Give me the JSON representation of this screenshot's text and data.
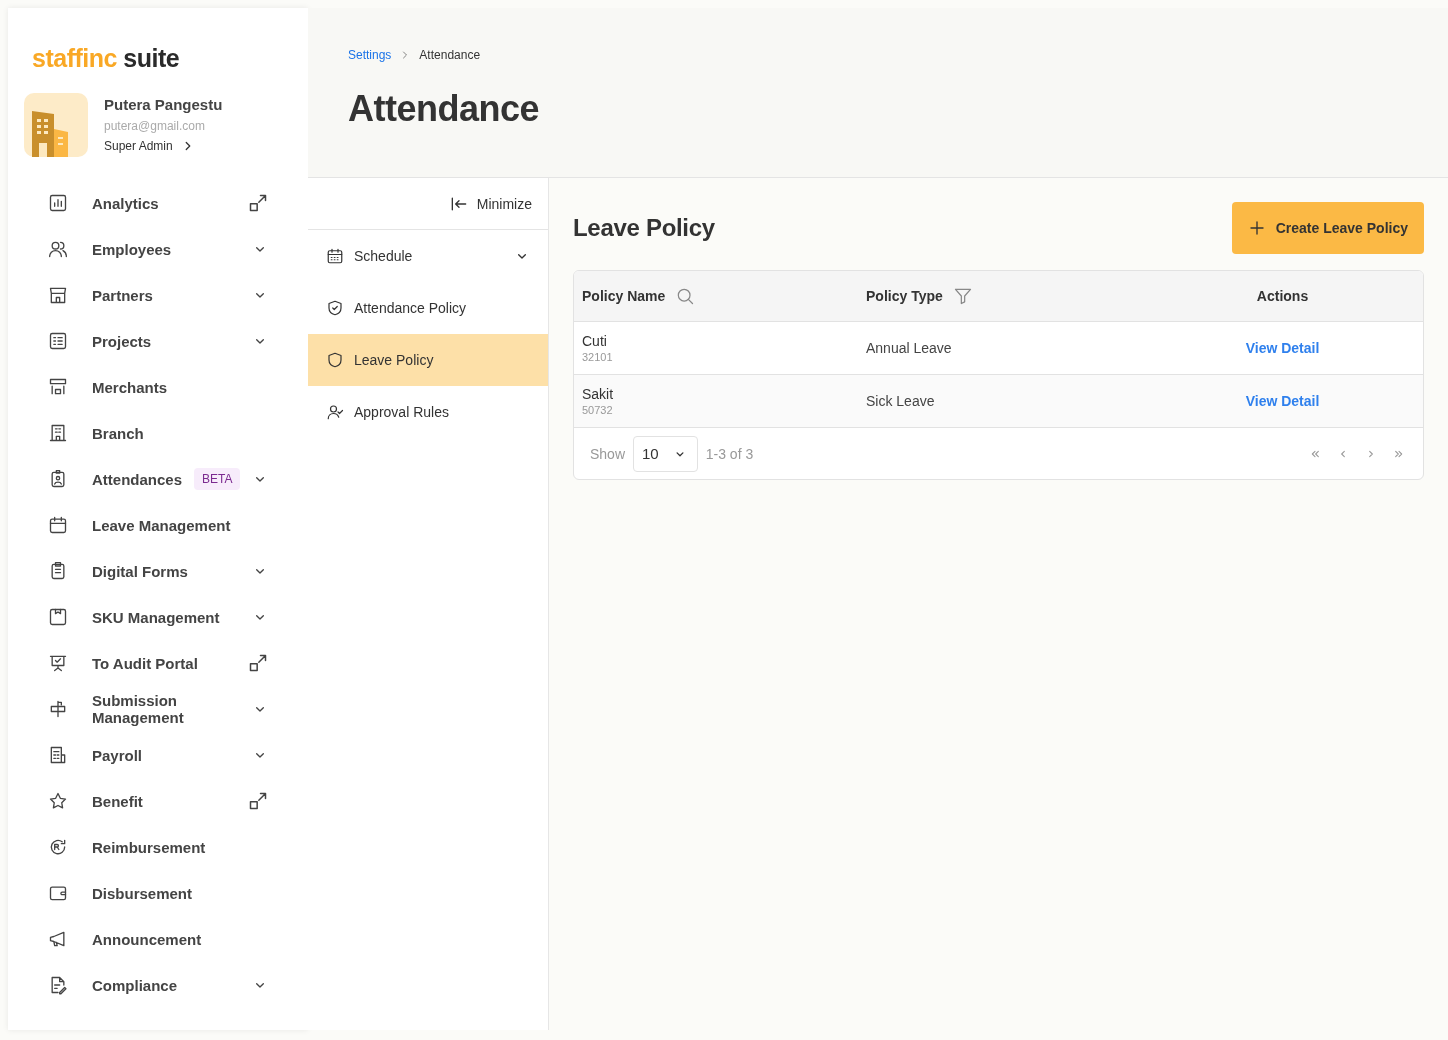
{
  "logo": {
    "brand": "staffinc",
    "product": "suite"
  },
  "profile": {
    "name": "Putera Pangestu",
    "email": "putera@gmail.com",
    "role": "Super Admin"
  },
  "sidebar": {
    "items": [
      {
        "label": "Analytics",
        "kind": "external"
      },
      {
        "label": "Employees",
        "kind": "expand"
      },
      {
        "label": "Partners",
        "kind": "expand"
      },
      {
        "label": "Projects",
        "kind": "expand"
      },
      {
        "label": "Merchants",
        "kind": "plain"
      },
      {
        "label": "Branch",
        "kind": "plain"
      },
      {
        "label": "Attendances",
        "kind": "expand",
        "badge": "BETA"
      },
      {
        "label": "Leave Management",
        "kind": "plain"
      },
      {
        "label": "Digital Forms",
        "kind": "expand"
      },
      {
        "label": "SKU Management",
        "kind": "expand"
      },
      {
        "label": "To Audit Portal",
        "kind": "external"
      },
      {
        "label": "Submission Management",
        "kind": "expand"
      },
      {
        "label": "Payroll",
        "kind": "expand"
      },
      {
        "label": "Benefit",
        "kind": "external"
      },
      {
        "label": "Reimbursement",
        "kind": "plain"
      },
      {
        "label": "Disbursement",
        "kind": "plain"
      },
      {
        "label": "Announcement",
        "kind": "plain"
      },
      {
        "label": "Compliance",
        "kind": "expand"
      }
    ]
  },
  "breadcrumb": [
    {
      "label": "Settings",
      "link": true
    },
    {
      "label": "Attendance",
      "link": false
    }
  ],
  "page_title": "Attendance",
  "subnav": {
    "minimize": "Minimize",
    "items": [
      {
        "label": "Schedule",
        "expandable": true,
        "selected": false
      },
      {
        "label": "Attendance Policy",
        "expandable": false,
        "selected": false
      },
      {
        "label": "Leave Policy",
        "expandable": false,
        "selected": true
      },
      {
        "label": "Approval Rules",
        "expandable": false,
        "selected": false
      }
    ]
  },
  "content": {
    "heading": "Leave Policy",
    "create_button": "Create Leave Policy",
    "table": {
      "columns": [
        {
          "label": "Policy Name",
          "kind": "search"
        },
        {
          "label": "Policy Type",
          "kind": "filter"
        },
        {
          "label": "Actions",
          "kind": "plain"
        }
      ],
      "rows": [
        {
          "name": "Cuti",
          "code": "32101",
          "type": "Annual Leave",
          "action": "View Detail"
        },
        {
          "name": "Sakit",
          "code": "50732",
          "type": "Sick Leave",
          "action": "View Detail"
        }
      ],
      "footer": {
        "show": "Show",
        "page_size": "10",
        "range": "1-3 of 3"
      }
    }
  }
}
